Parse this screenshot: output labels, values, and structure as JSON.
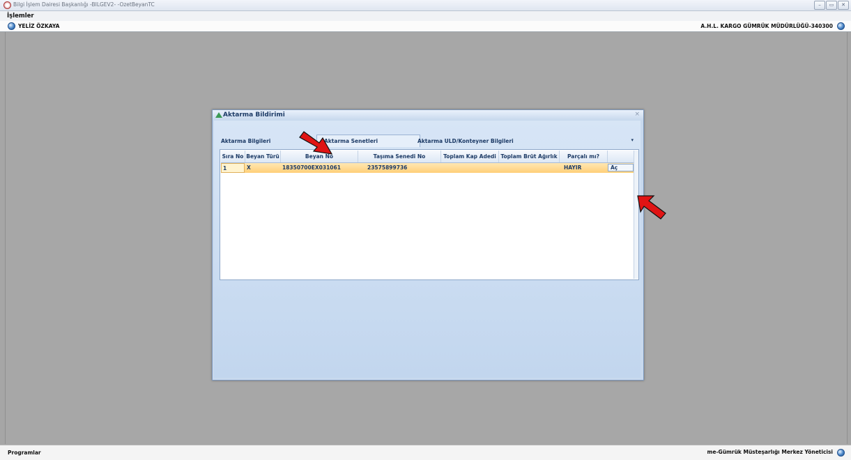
{
  "app": {
    "window_title": "Bilgi İşlem Dairesi Başkanlığı -BILGEV2- -OzetBeyanTC",
    "window_buttons": [
      "–",
      "▭",
      "✕"
    ]
  },
  "menu": {
    "items": [
      "İşlemler"
    ]
  },
  "userbar": {
    "user_name": "YELİZ ÖZKAYA",
    "office": "A.H.L. KARGO GÜMRÜK MÜDÜRLÜĞÜ-340300"
  },
  "statusbar": {
    "programs_label": "Programlar",
    "admin_label": "me-Gümrük Müsteşarlığı Merkez Yöneticisi"
  },
  "dialog": {
    "title": "Aktarma Bildirimi",
    "close_glyph": "×",
    "tabs": [
      {
        "label": "Aktarma Bilgileri",
        "active": false
      },
      {
        "label": "Aktarma Senetleri",
        "active": true
      },
      {
        "label": "Aktarma ULD/Konteyner Bilgileri",
        "active": false
      }
    ],
    "tab_menu_glyph": "▾",
    "grid": {
      "columns": [
        "Sıra No",
        "Beyan Türü",
        "Beyan No",
        "Taşıma Senedi No",
        "Toplam Kap Adedi",
        "Toplam Brüt Ağırlık",
        "Parçalı mı?",
        ""
      ],
      "rows": [
        {
          "sira_no": "1",
          "beyan_turu": "X",
          "beyan_no": "18350700EX031061",
          "tasima_senedi_no": "23575899736",
          "toplam_kap_adedi": "",
          "toplam_brut_agirlik": "",
          "parcali_mi": "HAYIR",
          "action_label": "Aç"
        }
      ]
    }
  },
  "colors": {
    "desktop": "#a7a7a7",
    "dialog_bg": "#c8d9ee",
    "selected_row": "#ffcf78",
    "annotation_arrow": "#e01414"
  },
  "icons": {
    "app": "app-logo-icon",
    "user": "user-info-icon",
    "dialog": "aktarma-triangle-icon",
    "annotations": [
      "red-arrow-icon",
      "red-arrow-icon"
    ]
  }
}
